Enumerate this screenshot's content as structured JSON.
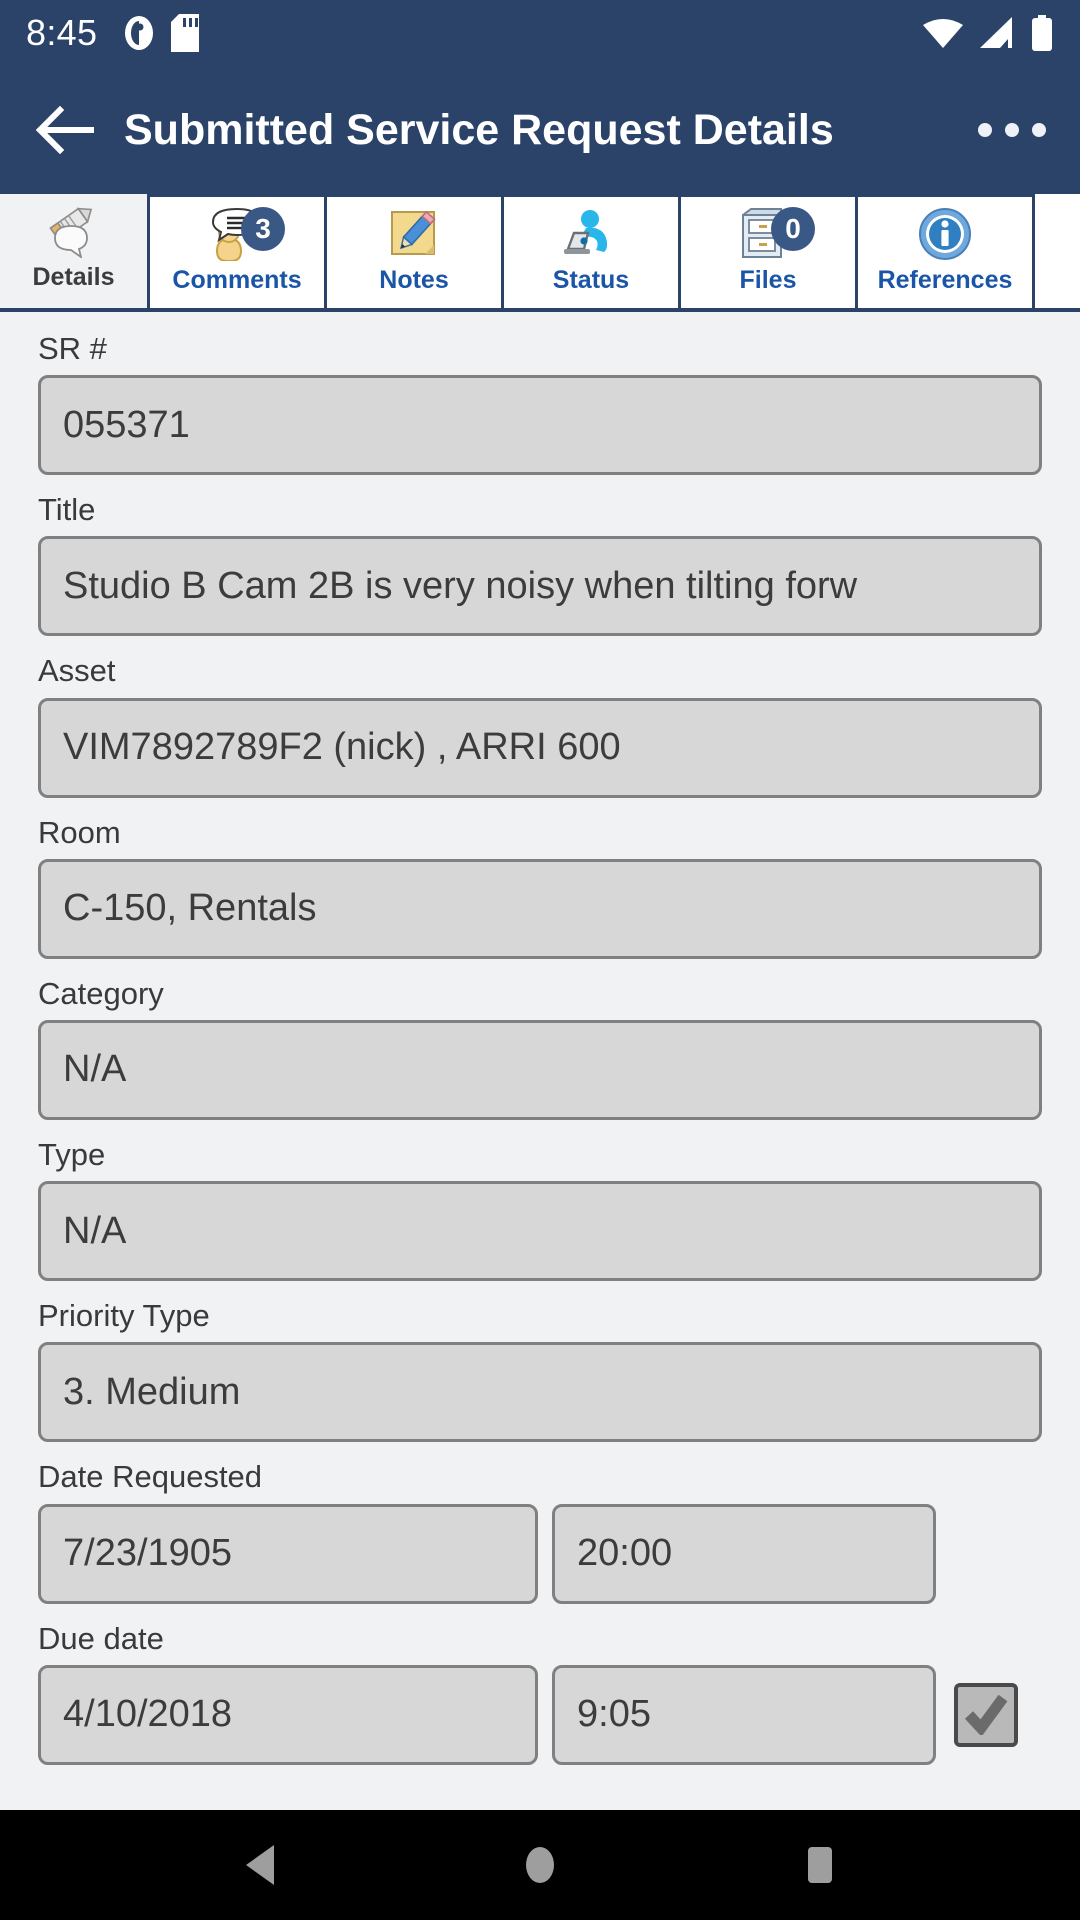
{
  "status_bar": {
    "time": "8:45",
    "left_icons": [
      "do-not-disturb-icon",
      "sd-card-icon"
    ],
    "right_icons": [
      "wifi-icon",
      "cellular-signal-icon",
      "battery-icon"
    ]
  },
  "app_bar": {
    "back_icon": "arrow-left-icon",
    "title": "Submitted Service Request Details",
    "overflow_icon": "more-horizontal-icon",
    "background_color": "#2b4368"
  },
  "tabs": [
    {
      "label": "Details",
      "icon": "pencil-comment-icon",
      "badge": null,
      "selected": true
    },
    {
      "label": "Comments",
      "icon": "user-speech-bubble-icon",
      "badge": "3",
      "selected": false
    },
    {
      "label": "Notes",
      "icon": "note-pencil-icon",
      "badge": null,
      "selected": false
    },
    {
      "label": "Status",
      "icon": "person-laptop-icon",
      "badge": null,
      "selected": false
    },
    {
      "label": "Files",
      "icon": "file-cabinet-icon",
      "badge": "0",
      "selected": false
    },
    {
      "label": "References",
      "icon": "info-circle-icon",
      "badge": null,
      "selected": false
    }
  ],
  "form": {
    "sr_number": {
      "label": "SR #",
      "value": "055371"
    },
    "title": {
      "label": "Title",
      "value": "Studio B Cam 2B is very noisy when tilting forw"
    },
    "asset": {
      "label": "Asset",
      "value": "VIM7892789F2 (nick) , ARRI 600"
    },
    "room": {
      "label": "Room",
      "value": "C-150, Rentals"
    },
    "category": {
      "label": "Category",
      "value": "N/A"
    },
    "type": {
      "label": "Type",
      "value": "N/A"
    },
    "priority_type": {
      "label": "Priority Type",
      "value": "3. Medium"
    },
    "date_requested": {
      "label": "Date Requested",
      "date": "7/23/1905",
      "time": "20:00"
    },
    "due_date": {
      "label": "Due date",
      "date": "4/10/2018",
      "time": "9:05",
      "checked": true
    }
  },
  "nav_bar": {
    "back": "triangle-back-icon",
    "home": "circle-home-icon",
    "recents": "square-recents-icon"
  },
  "colors": {
    "app_bar": "#2b4368",
    "tab_text": "#1a55a8",
    "field_bg": "#d7d7d7",
    "page_bg": "#f1f2f4"
  }
}
